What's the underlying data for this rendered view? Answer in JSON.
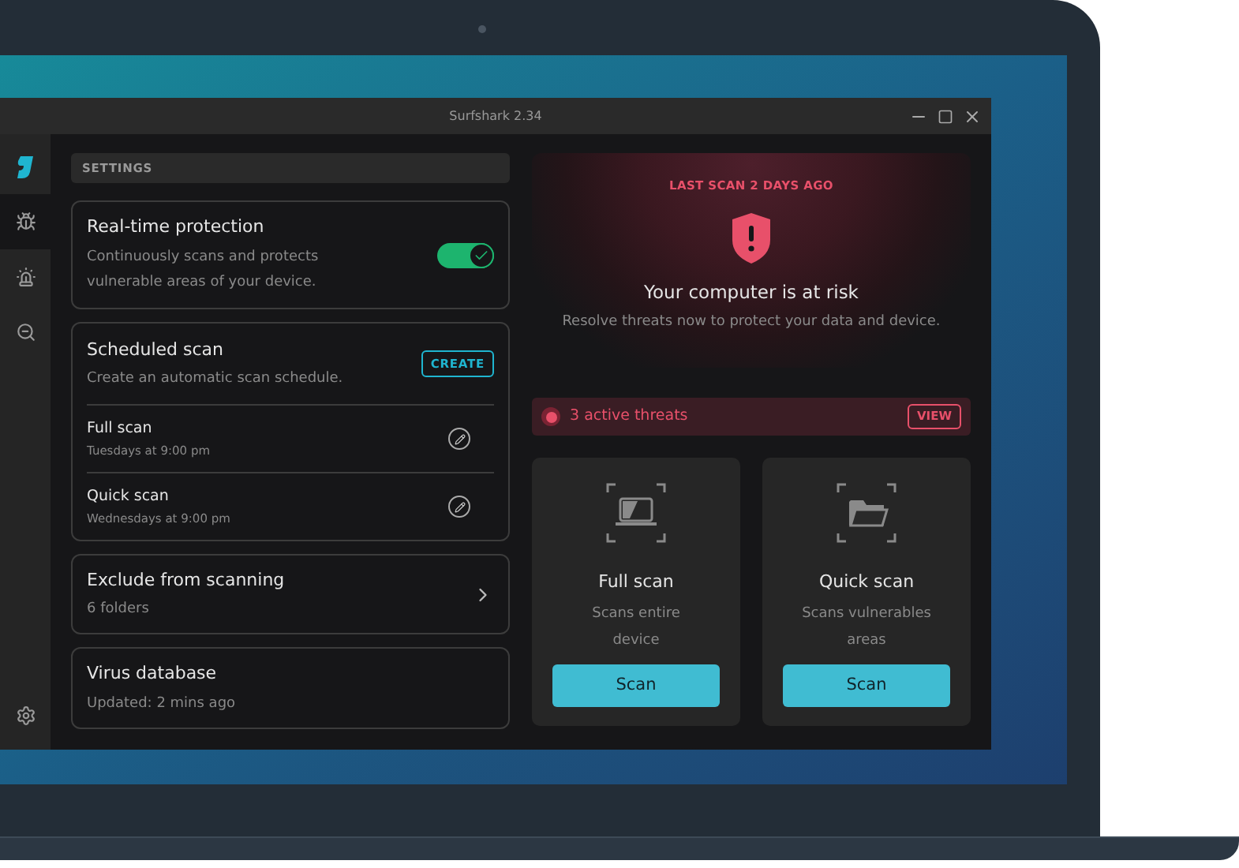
{
  "window": {
    "title": "Surfshark 2.34"
  },
  "sidebar": {
    "items": [
      {
        "kind": "logo",
        "selected": false
      },
      {
        "kind": "bug",
        "selected": true
      },
      {
        "kind": "alarm",
        "selected": false
      },
      {
        "kind": "search",
        "selected": false
      },
      {
        "kind": "settings",
        "selected": false
      }
    ]
  },
  "settings": {
    "header": "SETTINGS",
    "realtime": {
      "title": "Real-time protection",
      "description": "Continuously scans and protects vulnerable areas of your device.",
      "on": true
    },
    "scheduled": {
      "title": "Scheduled scan",
      "description": "Create an automatic scan schedule.",
      "button": "CREATE",
      "items": [
        {
          "name": "Full scan",
          "schedule": "Tuesdays at 9:00 pm"
        },
        {
          "name": "Quick scan",
          "schedule": "Wednesdays at 9:00 pm"
        }
      ]
    },
    "exclude": {
      "title": "Exclude from scanning",
      "subtitle": "6 folders"
    },
    "database": {
      "title": "Virus database",
      "subtitle": "Updated: 2 mins ago"
    }
  },
  "status": {
    "last_scan": "LAST SCAN 2 DAYS AGO",
    "title": "Your computer is at risk",
    "description": "Resolve threats now to protect your data and device."
  },
  "threats": {
    "label": "3 active threats",
    "button": "VIEW"
  },
  "scans": [
    {
      "kind": "full",
      "title": "Full scan",
      "description": "Scans entire device",
      "button": "Scan"
    },
    {
      "kind": "quick",
      "title": "Quick scan",
      "description": "Scans vulnerables areas",
      "button": "Scan"
    }
  ]
}
